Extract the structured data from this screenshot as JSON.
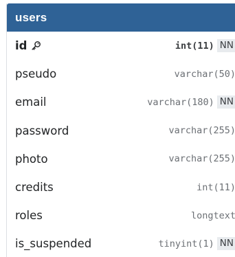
{
  "table": {
    "name": "users",
    "fields": [
      {
        "name": "id",
        "type": "int(11)",
        "nn": "NN",
        "primary_key": true,
        "icon": "key-icon"
      },
      {
        "name": "pseudo",
        "type": "varchar(50)",
        "nn": ""
      },
      {
        "name": "email",
        "type": "varchar(180)",
        "nn": "NN"
      },
      {
        "name": "password",
        "type": "varchar(255)",
        "nn": ""
      },
      {
        "name": "photo",
        "type": "varchar(255)",
        "nn": ""
      },
      {
        "name": "credits",
        "type": "int(11)",
        "nn": ""
      },
      {
        "name": "roles",
        "type": "longtext",
        "nn": ""
      },
      {
        "name": "is_suspended",
        "type": "tinyint(1)",
        "nn": "NN"
      }
    ]
  },
  "colors": {
    "header_bg": "#2f6296",
    "header_text": "#ffffff",
    "badge_bg": "#e8ebee"
  }
}
